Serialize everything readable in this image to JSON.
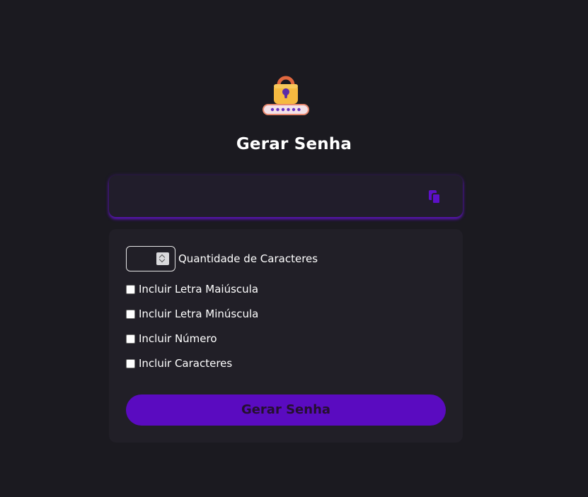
{
  "header": {
    "logo_icon": "padlock-password-icon",
    "title": "Gerar Senha"
  },
  "output": {
    "value": "",
    "copy_icon": "copy-icon"
  },
  "options": {
    "length": {
      "value": "",
      "label": "Quantidade de Caracteres"
    },
    "checkboxes": [
      {
        "label": "Incluir Letra Maiúscula",
        "checked": false
      },
      {
        "label": "Incluir Letra Minúscula",
        "checked": false
      },
      {
        "label": "Incluir Número",
        "checked": false
      },
      {
        "label": "Incluir Caracteres",
        "checked": false
      }
    ]
  },
  "generate_button": {
    "label": "Gerar Senha"
  },
  "colors": {
    "background": "#1b1a20",
    "card": "#211f27",
    "accent": "#5a0bc0",
    "button_text": "#25102f"
  }
}
